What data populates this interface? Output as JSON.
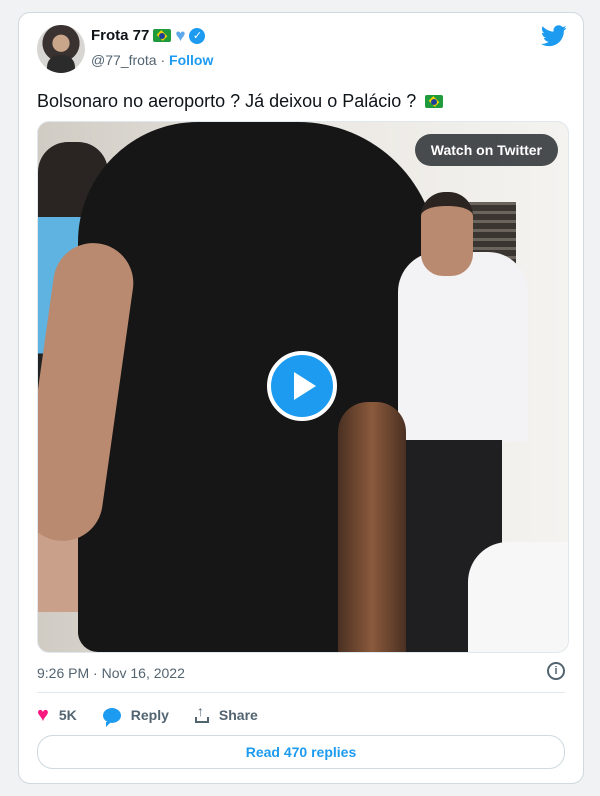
{
  "author": {
    "name": "Frota 77",
    "handle": "@77_frota",
    "follow_label": "Follow",
    "separator": "·"
  },
  "tweet": {
    "text": "Bolsonaro no aeroporto  ? Já deixou o Palácio ?",
    "timestamp": "9:26 PM · Nov 16, 2022"
  },
  "media": {
    "watch_label": "Watch on Twitter"
  },
  "actions": {
    "likes": "5K",
    "reply_label": "Reply",
    "share_label": "Share",
    "read_replies_label": "Read 470 replies"
  },
  "colors": {
    "accent": "#1d9bf0",
    "like": "#f91880"
  }
}
